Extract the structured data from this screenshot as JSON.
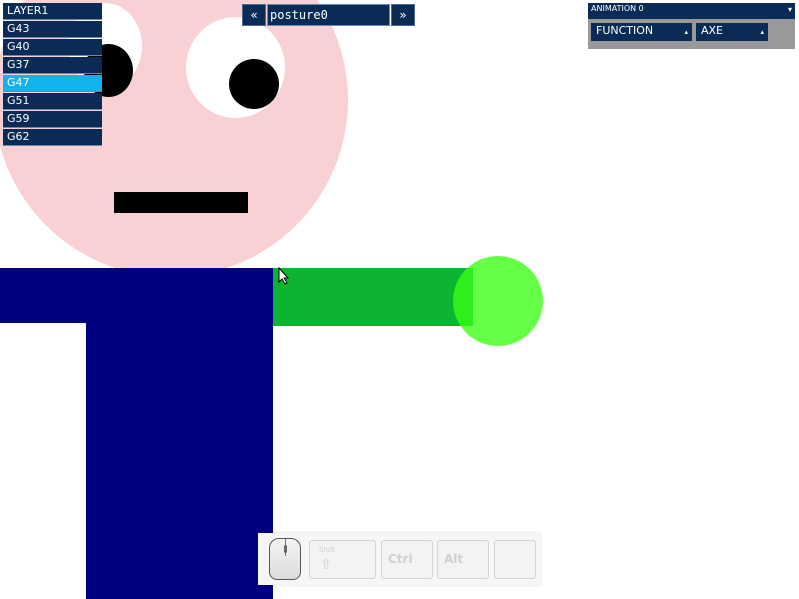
{
  "layers": {
    "items": [
      {
        "label": "LAYER1",
        "selected": false
      },
      {
        "label": "G43",
        "selected": false
      },
      {
        "label": "G40",
        "selected": false
      },
      {
        "label": "G37",
        "selected": false
      },
      {
        "label": "G47",
        "selected": true
      },
      {
        "label": "G51",
        "selected": false
      },
      {
        "label": "G59",
        "selected": false
      },
      {
        "label": "G62",
        "selected": false
      }
    ]
  },
  "posture": {
    "prev_label": "«",
    "next_label": "»",
    "name": "posture0"
  },
  "animation": {
    "title": "ANIMATION 0",
    "title_caret": "▾",
    "function_label": "FUNCTION",
    "axe_label": "AXE",
    "dropdown_caret": "▴"
  },
  "input_overlay": {
    "shift_label": "Shift",
    "shift_arrow": "⇧",
    "ctrl_label": "Ctrl",
    "alt_label": "Alt",
    "mouse_icon": "mouse-icon"
  },
  "colors": {
    "head": "#f9d0d3",
    "body": "#000080",
    "arm_right": "#0db431",
    "hand": "#3aff14",
    "panel": "#0a2b56",
    "selected": "#11b3ee"
  }
}
